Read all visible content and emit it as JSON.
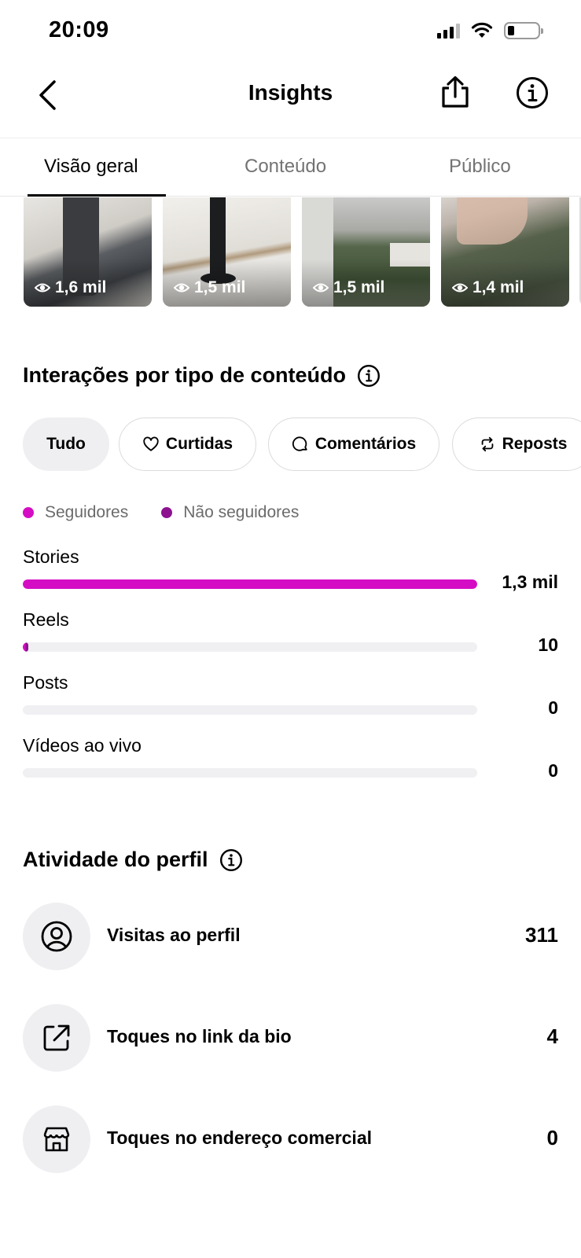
{
  "status_bar": {
    "time": "20:09"
  },
  "header": {
    "title": "Insights"
  },
  "tabs": [
    {
      "label": "Visão geral",
      "active": true
    },
    {
      "label": "Conteúdo",
      "active": false
    },
    {
      "label": "Público",
      "active": false
    }
  ],
  "thumbnails": [
    {
      "views": "1,6 mil"
    },
    {
      "views": "1,5 mil"
    },
    {
      "views": "1,5 mil"
    },
    {
      "views": "1,4 mil"
    }
  ],
  "interactions": {
    "title": "Interações por tipo de conteúdo",
    "chips": [
      {
        "label": "Tudo",
        "icon": "none",
        "selected": true
      },
      {
        "label": "Curtidas",
        "icon": "heart-icon",
        "selected": false
      },
      {
        "label": "Comentários",
        "icon": "comment-icon",
        "selected": false
      },
      {
        "label": "Reposts",
        "icon": "repost-icon",
        "selected": false
      }
    ],
    "legend": [
      {
        "label": "Seguidores",
        "color": "#d40dc4"
      },
      {
        "label": "Não seguidores",
        "color": "#8d1290"
      }
    ],
    "rows": [
      {
        "label": "Stories",
        "value": "1,3 mil",
        "fraction": 1.0
      },
      {
        "label": "Reels",
        "value": "10",
        "fraction": 0.008
      },
      {
        "label": "Posts",
        "value": "0",
        "fraction": 0
      },
      {
        "label": "Vídeos ao vivo",
        "value": "0",
        "fraction": 0
      }
    ]
  },
  "profile_activity": {
    "title": "Atividade do perfil",
    "rows": [
      {
        "label": "Visitas ao perfil",
        "value": "311",
        "icon": "user-circle-icon"
      },
      {
        "label": "Toques no link da bio",
        "value": "4",
        "icon": "external-link-icon"
      },
      {
        "label": "Toques no endereço comercial",
        "value": "0",
        "icon": "storefront-icon"
      }
    ]
  }
}
